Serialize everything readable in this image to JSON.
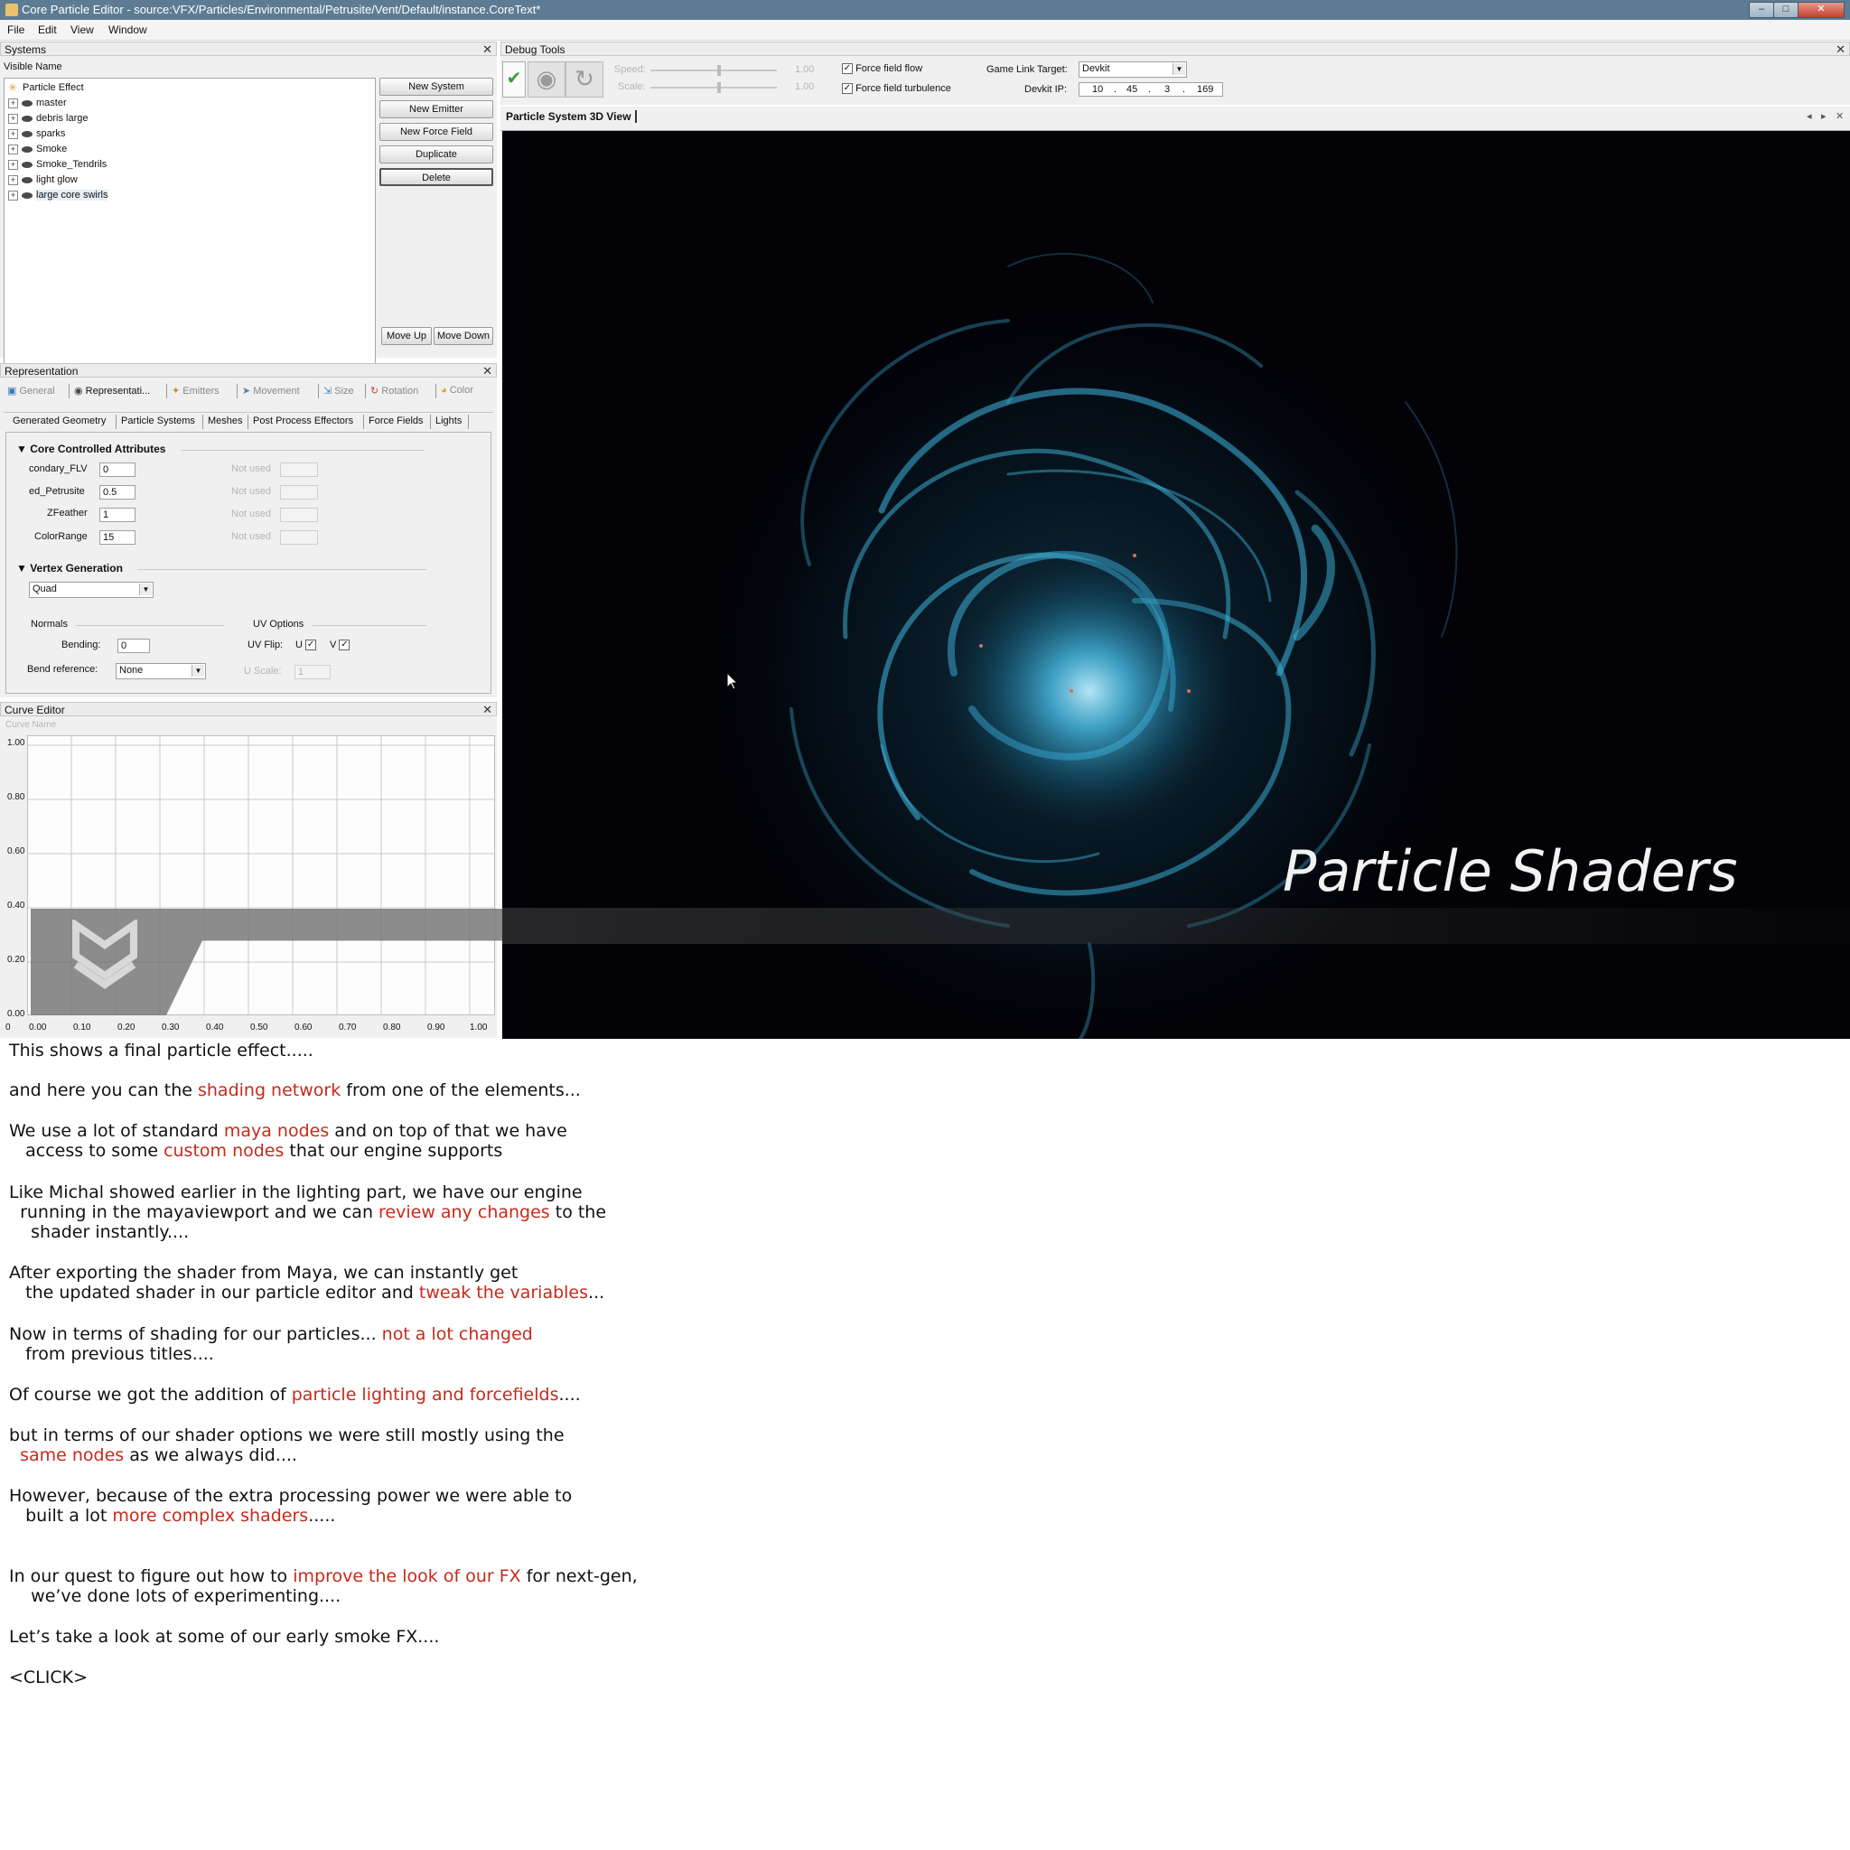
{
  "window": {
    "title": "Core Particle Editor - source:VFX/Particles/Environmental/Petrusite/Vent/Default/instance.CoreText*",
    "controls": [
      "–",
      "□",
      "✕"
    ]
  },
  "menu": [
    "File",
    "Edit",
    "View",
    "Window"
  ],
  "systems_panel": {
    "title": "Systems",
    "column_header": "Visible Name",
    "root": "Particle Effect",
    "items": [
      "master",
      "debris large",
      "sparks",
      "Smoke",
      "Smoke_Tendrils",
      "light glow",
      "large core swirls"
    ],
    "buttons": {
      "new_system": "New System",
      "new_emitter": "New Emitter",
      "new_force_field": "New Force Field",
      "duplicate": "Duplicate",
      "delete": "Delete",
      "move_up": "Move Up",
      "move_down": "Move Down"
    }
  },
  "representation_panel": {
    "title": "Representation",
    "main_tabs": [
      "General",
      "Representati...",
      "Emitters",
      "Movement",
      "Size",
      "Rotation",
      "Color"
    ],
    "sub_tabs": [
      "Generated Geometry",
      "Particle Systems",
      "Meshes",
      "Post Process Effectors",
      "Force Fields",
      "Lights"
    ],
    "core_section": "Core Controlled Attributes",
    "attributes": [
      {
        "label": "condary_FLV",
        "value": "0",
        "unused": "Not used"
      },
      {
        "label": "ed_Petrusite",
        "value": "0.5",
        "unused": "Not used"
      },
      {
        "label": "ZFeather",
        "value": "1",
        "unused": "Not used"
      },
      {
        "label": "ColorRange",
        "value": "15",
        "unused": "Not used"
      }
    ],
    "vertex_section": "Vertex Generation",
    "vertex_type": "Quad",
    "normals_label": "Normals",
    "uv_options_label": "UV Options",
    "bending_label": "Bending:",
    "bending_value": "0",
    "uv_flip_label": "UV Flip:",
    "uv_u": "U",
    "uv_v": "V",
    "uv_u_checked": true,
    "uv_v_checked": true,
    "bend_reference_label": "Bend reference:",
    "bend_reference_value": "None",
    "u_scale_label": "U Scale:",
    "u_scale_value": "1"
  },
  "curve_editor": {
    "title": "Curve Editor",
    "column_header": "Curve Name",
    "y_ticks": [
      "1.00",
      "0.80",
      "0.60",
      "0.40",
      "0.20",
      "0.00"
    ],
    "x_ticks": [
      "0",
      "0.00",
      "0.10",
      "0.20",
      "0.30",
      "0.40",
      "0.50",
      "0.60",
      "0.70",
      "0.80",
      "0.90",
      "1.00"
    ]
  },
  "debug_tools": {
    "title": "Debug Tools",
    "speed_label": "Speed:",
    "speed_value": "1.00",
    "scale_label": "Scale:",
    "scale_value": "1.00",
    "force_field_flow": "Force field flow",
    "force_field_turbulence": "Force field turbulence",
    "game_link_label": "Game Link Target:",
    "game_link_value": "Devkit",
    "devkit_ip_label": "Devkit IP:",
    "ip": [
      "10",
      "45",
      "3",
      "169"
    ]
  },
  "viewport": {
    "tab_label": "Particle System 3D View",
    "overlay_title": "Particle Shaders",
    "nav": [
      "◂",
      "▸",
      "✕"
    ]
  },
  "colors": {
    "titlebar": "#5d7c93",
    "highlight": "#c62a1b",
    "particle": "#3fb7e0",
    "viewport_bg": "#020207"
  },
  "notes": [
    [
      {
        "t": "This shows a final particle effect....."
      }
    ],
    [
      {
        "t": "and here you can the "
      },
      {
        "t": "shading network",
        "hl": true
      },
      {
        "t": " from one of the elements..."
      }
    ],
    [
      {
        "t": "We use a lot of standard "
      },
      {
        "t": "maya nodes",
        "hl": true
      },
      {
        "t": " and on top of that we have"
      }
    ],
    [
      {
        "t": "   access to some "
      },
      {
        "t": "custom nodes",
        "hl": true
      },
      {
        "t": " that our engine supports"
      }
    ],
    [
      {
        "t": "Like Michal showed earlier in the lighting part, we have our engine"
      }
    ],
    [
      {
        "t": "  running in the mayaviewport and we can "
      },
      {
        "t": "review any changes",
        "hl": true
      },
      {
        "t": " to the"
      }
    ],
    [
      {
        "t": "    shader instantly...."
      }
    ],
    [
      {
        "t": "After exporting the shader from Maya, we can instantly get"
      }
    ],
    [
      {
        "t": "   the updated shader in our particle editor and "
      },
      {
        "t": "tweak the variables",
        "hl": true
      },
      {
        "t": "..."
      }
    ],
    [
      {
        "t": "Now in terms of shading for our particles... "
      },
      {
        "t": "not a lot changed",
        "hl": true
      }
    ],
    [
      {
        "t": "   from previous titles...."
      }
    ],
    [
      {
        "t": "Of course we got the addition of "
      },
      {
        "t": "particle lighting and forcefields",
        "hl": true
      },
      {
        "t": "...."
      }
    ],
    [
      {
        "t": "but in terms of our shader options we were still mostly using the"
      }
    ],
    [
      {
        "t": "  "
      },
      {
        "t": "same nodes",
        "hl": true
      },
      {
        "t": " as we always did...."
      }
    ],
    [
      {
        "t": "However, because of the extra processing power we were able to"
      }
    ],
    [
      {
        "t": "   built a lot "
      },
      {
        "t": "more complex shaders",
        "hl": true
      },
      {
        "t": "....."
      }
    ],
    [
      {
        "t": "In our quest to figure out how to "
      },
      {
        "t": "improve the look of our FX",
        "hl": true
      },
      {
        "t": " for next-gen,"
      }
    ],
    [
      {
        "t": "    we’ve done lots of experimenting...."
      }
    ],
    [
      {
        "t": "Let’s take a look at some of our early smoke FX...."
      }
    ],
    [
      {
        "t": "<CLICK>"
      }
    ]
  ]
}
